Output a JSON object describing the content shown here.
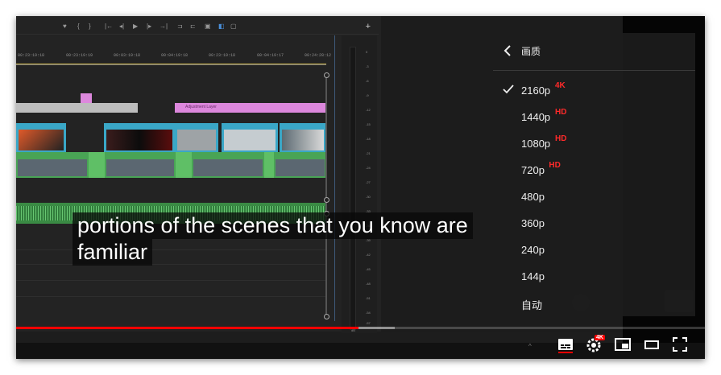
{
  "captions": [
    "portions of the scenes that you know are",
    "familiar"
  ],
  "ruler_ticks": [
    "00:23:19:18",
    "00:23:19:19",
    "00:03:19:18",
    "00:04:19:18",
    "00:23:19:18",
    "00:04:19:17",
    "00:24:28:12"
  ],
  "meter_numbers": [
    "0",
    "-3",
    "-6",
    "-9",
    "-12",
    "-15",
    "-18",
    "-21",
    "-24",
    "-27",
    "-30",
    "-33",
    "-36",
    "-39",
    "-42",
    "-45",
    "-48",
    "-51",
    "-54",
    "-57",
    "dB"
  ],
  "adjustment_label": "Adjustment Layer",
  "quality_menu": {
    "title": "画质",
    "options": [
      {
        "label": "2160p",
        "badge": "4K",
        "selected": true
      },
      {
        "label": "1440p",
        "badge": "HD",
        "selected": false
      },
      {
        "label": "1080p",
        "badge": "HD",
        "selected": false
      },
      {
        "label": "720p",
        "badge": "HD",
        "selected": false
      },
      {
        "label": "480p",
        "badge": "",
        "selected": false
      },
      {
        "label": "360p",
        "badge": "",
        "selected": false
      },
      {
        "label": "240p",
        "badge": "",
        "selected": false
      },
      {
        "label": "144p",
        "badge": "",
        "selected": false
      },
      {
        "label": "自动",
        "badge": "",
        "selected": false
      }
    ]
  },
  "settings_badge": "4K",
  "progress": {
    "played_fraction": 0.497,
    "buffered_fraction": 0.55
  },
  "colors": {
    "progress": "#ff0000",
    "badge": "#ff2a2a",
    "timeline_audio": "#3a8a44",
    "clip_blue": "#3aa7c7",
    "clip_green": "#49a455",
    "adjustment": "#dc87dc"
  }
}
